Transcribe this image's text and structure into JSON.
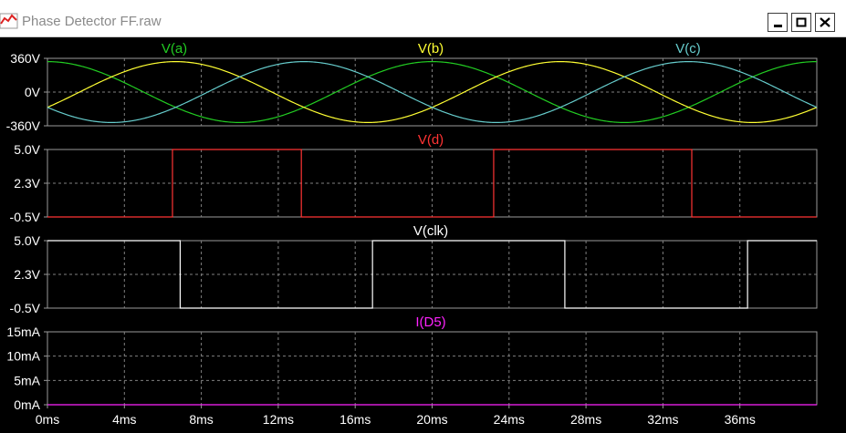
{
  "window": {
    "title": "Phase Detector FF.raw",
    "buttons": [
      "minimize-icon",
      "maximize-icon",
      "close-icon"
    ]
  },
  "colors": {
    "background": "#000000",
    "grid": "#808080",
    "axis_text": "#ffffff",
    "va": "#22cc22",
    "vb": "#ffff33",
    "vc": "#66cccc",
    "vd": "#ff3333",
    "vclk": "#ffffff",
    "id5": "#ff22ff"
  },
  "chart_data": [
    {
      "type": "line",
      "series": [
        {
          "name": "V(a)",
          "amplitude": 325,
          "period_ms": 20,
          "phase_deg": 90
        },
        {
          "name": "V(b)",
          "amplitude": 325,
          "period_ms": 20,
          "phase_deg": -30
        },
        {
          "name": "V(c)",
          "amplitude": 325,
          "period_ms": 20,
          "phase_deg": 210
        }
      ],
      "xlim": [
        0,
        40
      ],
      "ylim": [
        -360,
        360
      ],
      "yticks": [
        "360V",
        "0V",
        "-360V"
      ]
    },
    {
      "type": "line",
      "series": [
        {
          "name": "V(d)",
          "x": [
            0,
            6.5,
            6.5,
            13.2,
            13.2,
            23.2,
            23.2,
            33.5,
            33.5,
            40
          ],
          "y": [
            -0.5,
            -0.5,
            5,
            5,
            -0.5,
            -0.5,
            5,
            5,
            -0.5,
            -0.5
          ]
        }
      ],
      "xlim": [
        0,
        40
      ],
      "ylim": [
        -0.5,
        5.0
      ],
      "yticks": [
        "5.0V",
        "2.3V",
        "-0.5V"
      ]
    },
    {
      "type": "line",
      "series": [
        {
          "name": "V(clk)",
          "x": [
            0,
            6.9,
            6.9,
            16.9,
            16.9,
            26.9,
            26.9,
            36.4,
            36.4,
            40
          ],
          "y": [
            5,
            5,
            -0.5,
            -0.5,
            5,
            5,
            -0.5,
            -0.5,
            5,
            5
          ]
        }
      ],
      "xlim": [
        0,
        40
      ],
      "ylim": [
        -0.5,
        5.0
      ],
      "yticks": [
        "5.0V",
        "2.3V",
        "-0.5V"
      ]
    },
    {
      "type": "line",
      "series": [
        {
          "name": "I(D5)",
          "x": [
            0,
            40
          ],
          "y": [
            0,
            0
          ]
        }
      ],
      "xlim": [
        0,
        40
      ],
      "ylim": [
        0,
        15
      ],
      "yticks": [
        "15mA",
        "10mA",
        "5mA",
        "0mA"
      ]
    }
  ],
  "xaxis": {
    "ticks": [
      "0ms",
      "4ms",
      "8ms",
      "12ms",
      "16ms",
      "20ms",
      "24ms",
      "28ms",
      "32ms",
      "36ms"
    ],
    "values": [
      0,
      4,
      8,
      12,
      16,
      20,
      24,
      28,
      32,
      36
    ]
  }
}
